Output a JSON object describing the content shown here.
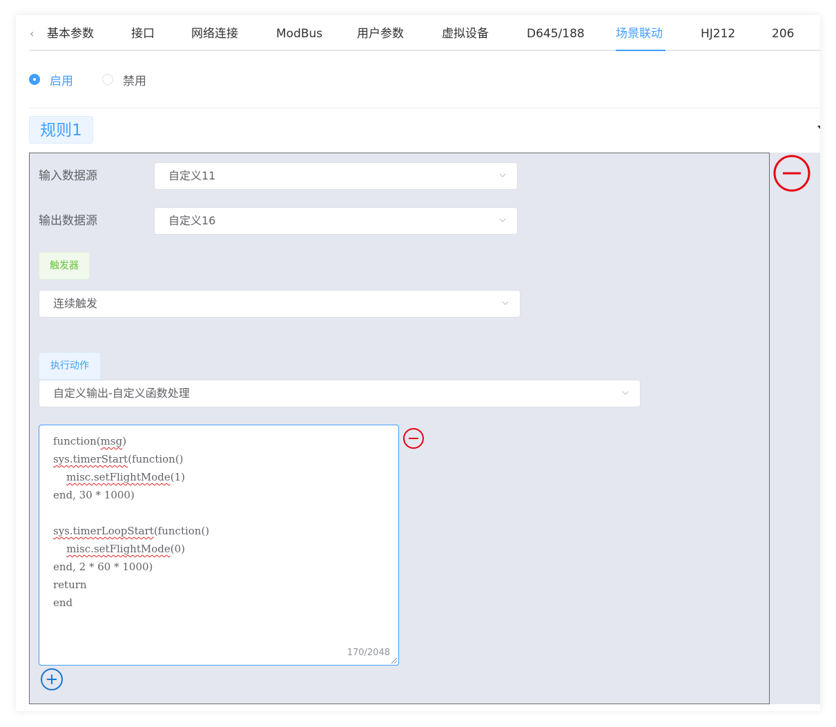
{
  "tabs": {
    "items": [
      "基本参数",
      "接口",
      "网络连接",
      "ModBus",
      "用户参数",
      "虚拟设备",
      "D645/188",
      "场景联动",
      "HJ212",
      "206"
    ],
    "active": "场景联动"
  },
  "status": {
    "enable_label": "启用",
    "disable_label": "禁用",
    "selected": "启用"
  },
  "rule": {
    "title": "规则1",
    "input_source": {
      "label": "输入数据源",
      "value": "自定义11"
    },
    "output_source": {
      "label": "输出数据源",
      "value": "自定义16"
    },
    "trigger": {
      "tag": "触发器",
      "value": "连续触发"
    },
    "action": {
      "tag": "执行动作",
      "value": "自定义输出-自定义函数处理",
      "code_lines": [
        [
          {
            "t": "function("
          },
          {
            "t": "msg",
            "err": true
          },
          {
            "t": ")"
          }
        ],
        [
          {
            "t": "sys.timerStart",
            "err": true
          },
          {
            "t": "(function()"
          }
        ],
        [
          {
            "t": "    "
          },
          {
            "t": "misc.setFlightMode",
            "err": true
          },
          {
            "t": "(1)"
          }
        ],
        [
          {
            "t": "end, 30 * 1000)"
          }
        ],
        [
          {
            "t": ""
          }
        ],
        [
          {
            "t": "sys.timerLoopStart",
            "err": true
          },
          {
            "t": "(function()"
          }
        ],
        [
          {
            "t": "    "
          },
          {
            "t": "misc.setFlightMode",
            "err": true
          },
          {
            "t": "(0)"
          }
        ],
        [
          {
            "t": "end, 2 * 60 * 1000)"
          }
        ],
        [
          {
            "t": "return"
          }
        ],
        [
          {
            "t": "end"
          }
        ]
      ],
      "char_count": "170/2048"
    }
  },
  "colors": {
    "primary": "#409eff",
    "danger": "#e60012",
    "success": "#67c23a",
    "panel_bg": "#e4e7ef"
  }
}
